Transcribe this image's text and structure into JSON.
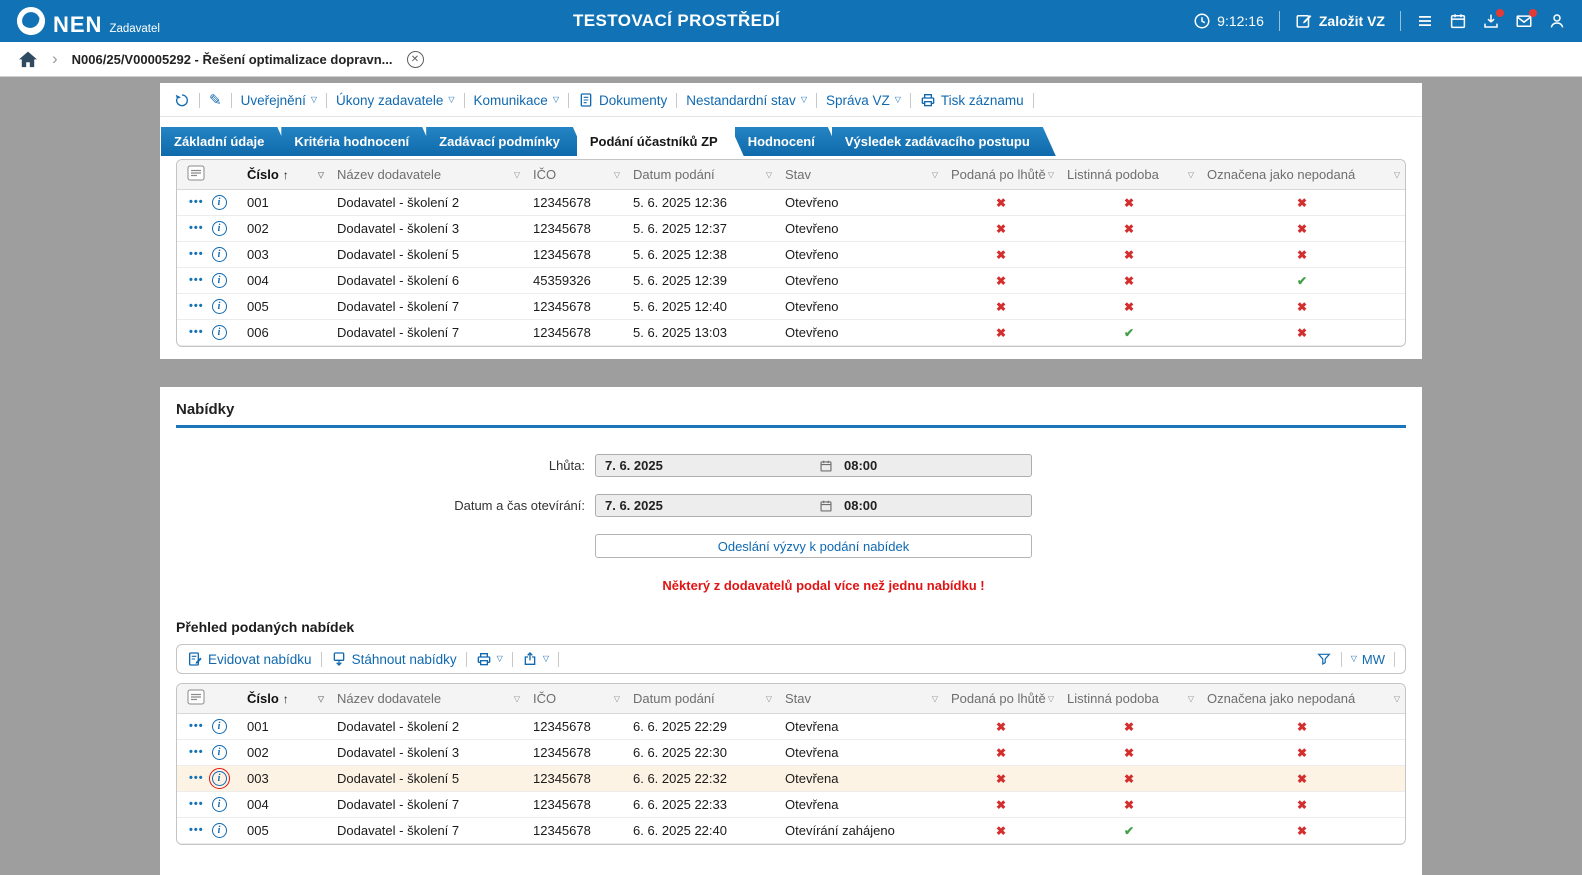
{
  "header": {
    "brand": "NEN",
    "brand_sub": "Zadavatel",
    "env_title": "TESTOVACÍ PROSTŘEDÍ",
    "clock": "9:12:16",
    "create_vz": "Založit VZ"
  },
  "breadcrumb": {
    "item": "N006/25/V00005292 - Řešení optimalizace dopravn..."
  },
  "toolbar": {
    "uverejneni": "Uveřejnění",
    "ukony": "Úkony zadavatele",
    "komunikace": "Komunikace",
    "dokumenty": "Dokumenty",
    "nestandardni": "Nestandardní stav",
    "sprava": "Správa VZ",
    "tisk": "Tisk záznamu"
  },
  "tabs": [
    {
      "label": "Základní údaje",
      "active": false
    },
    {
      "label": "Kritéria hodnocení",
      "active": false
    },
    {
      "label": "Zadávací podmínky",
      "active": false
    },
    {
      "label": "Podání účastníků ZP",
      "active": true
    },
    {
      "label": "Hodnocení",
      "active": false
    },
    {
      "label": "Výsledek zadávacího postupu",
      "active": false
    }
  ],
  "table_columns": {
    "cislo": "Číslo",
    "dodavatel": "Název dodavatele",
    "ico": "IČO",
    "datum": "Datum podání",
    "stav": "Stav",
    "po_lhute": "Podaná po lhůtě",
    "listinna": "Listinná podoba",
    "nepodana": "Označena jako nepodaná"
  },
  "participants_table": {
    "rows": [
      {
        "cislo": "001",
        "dodavatel": "Dodavatel - školení 2",
        "ico": "12345678",
        "datum": "5. 6. 2025 12:36",
        "stav": "Otevřeno",
        "po_lhute": false,
        "listinna": false,
        "nepodana": false
      },
      {
        "cislo": "002",
        "dodavatel": "Dodavatel - školení 3",
        "ico": "12345678",
        "datum": "5. 6. 2025 12:37",
        "stav": "Otevřeno",
        "po_lhute": false,
        "listinna": false,
        "nepodana": false
      },
      {
        "cislo": "003",
        "dodavatel": "Dodavatel - školení 5",
        "ico": "12345678",
        "datum": "5. 6. 2025 12:38",
        "stav": "Otevřeno",
        "po_lhute": false,
        "listinna": false,
        "nepodana": false
      },
      {
        "cislo": "004",
        "dodavatel": "Dodavatel - školení 6",
        "ico": "45359326",
        "datum": "5. 6. 2025 12:39",
        "stav": "Otevřeno",
        "po_lhute": false,
        "listinna": false,
        "nepodana": true
      },
      {
        "cislo": "005",
        "dodavatel": "Dodavatel - školení 7",
        "ico": "12345678",
        "datum": "5. 6. 2025 12:40",
        "stav": "Otevřeno",
        "po_lhute": false,
        "listinna": false,
        "nepodana": false
      },
      {
        "cislo": "006",
        "dodavatel": "Dodavatel - školení 7",
        "ico": "12345678",
        "datum": "5. 6. 2025 13:03",
        "stav": "Otevřeno",
        "po_lhute": false,
        "listinna": true,
        "nepodana": false
      }
    ]
  },
  "nabidky": {
    "section_title": "Nabídky",
    "lhuta_label": "Lhůta:",
    "lhuta_date": "7. 6. 2025",
    "lhuta_time": "08:00",
    "otevirani_label": "Datum a čas otevírání:",
    "otevirani_date": "7. 6. 2025",
    "otevirani_time": "08:00",
    "send_button": "Odeslání výzvy k podání nabídek",
    "warning": "Některý z dodavatelů podal více než jednu nabídku !",
    "prehled_title": "Přehled podaných nabídek",
    "evidovat": "Evidovat nabídku",
    "stahnout": "Stáhnout nabídky",
    "mw": "MW"
  },
  "offers_table": {
    "rows": [
      {
        "cislo": "001",
        "dodavatel": "Dodavatel - školení 2",
        "ico": "12345678",
        "datum": "6. 6. 2025 22:29",
        "stav": "Otevřena",
        "po_lhute": false,
        "listinna": false,
        "nepodana": false
      },
      {
        "cislo": "002",
        "dodavatel": "Dodavatel - školení 3",
        "ico": "12345678",
        "datum": "6. 6. 2025 22:30",
        "stav": "Otevřena",
        "po_lhute": false,
        "listinna": false,
        "nepodana": false
      },
      {
        "cislo": "003",
        "dodavatel": "Dodavatel - školení 5",
        "ico": "12345678",
        "datum": "6. 6. 2025 22:32",
        "stav": "Otevřena",
        "po_lhute": false,
        "listinna": false,
        "nepodana": false,
        "highlighted": true,
        "focused": true
      },
      {
        "cislo": "004",
        "dodavatel": "Dodavatel - školení 7",
        "ico": "12345678",
        "datum": "6. 6. 2025 22:33",
        "stav": "Otevřena",
        "po_lhute": false,
        "listinna": false,
        "nepodana": false
      },
      {
        "cislo": "005",
        "dodavatel": "Dodavatel - školení 7",
        "ico": "12345678",
        "datum": "6. 6. 2025 22:40",
        "stav": "Otevírání zahájeno",
        "po_lhute": false,
        "listinna": true,
        "nepodana": false
      }
    ]
  },
  "colors": {
    "header_blue": "#1173b5",
    "link_blue": "#1069b0",
    "cross_red": "#d32f2f",
    "check_green": "#43a047",
    "warning_red": "#e01414"
  }
}
